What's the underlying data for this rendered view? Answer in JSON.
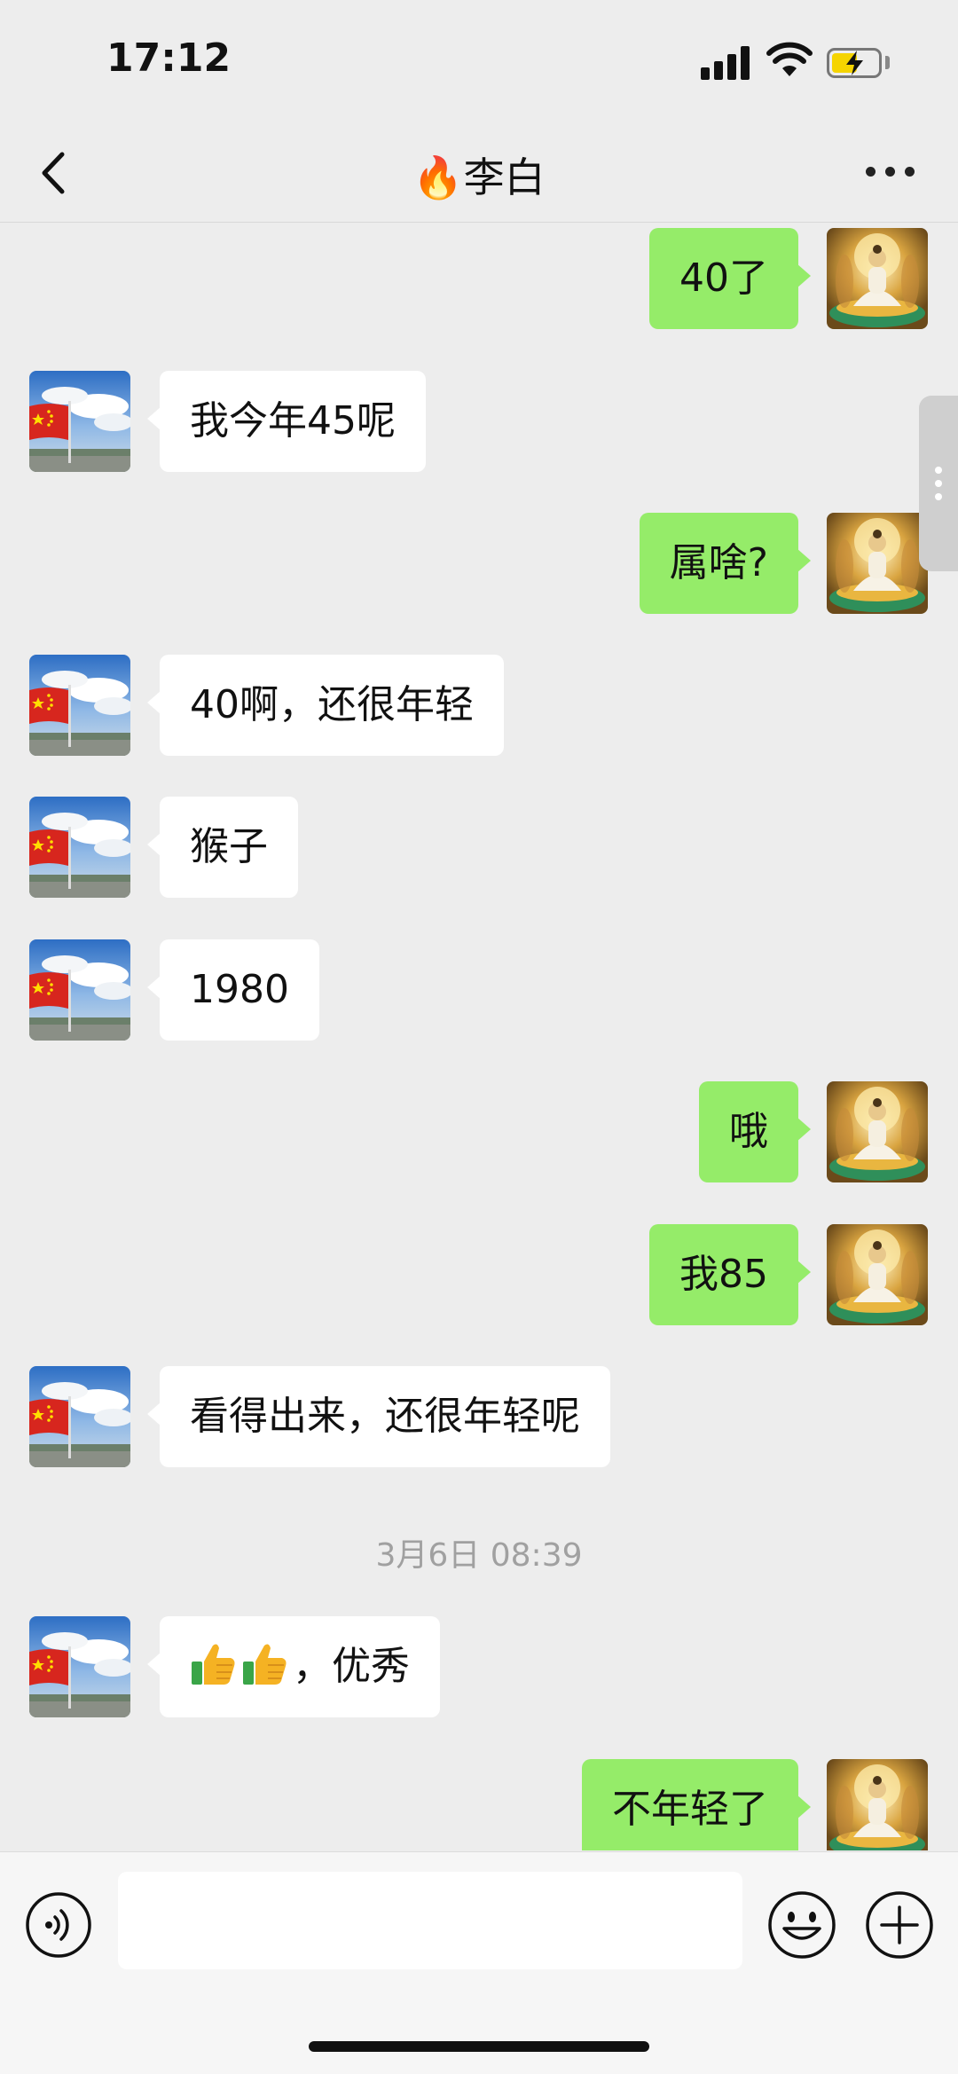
{
  "status": {
    "time": "17:12"
  },
  "header": {
    "title": "🔥李白"
  },
  "messages": [
    {
      "side": "right",
      "text": "40了"
    },
    {
      "side": "left",
      "text": "我今年45呢"
    },
    {
      "side": "right",
      "text": "属啥?"
    },
    {
      "side": "left",
      "text": "40啊，还很年轻"
    },
    {
      "side": "left",
      "text": "猴子"
    },
    {
      "side": "left",
      "text": "1980"
    },
    {
      "side": "right",
      "text": "哦"
    },
    {
      "side": "right",
      "text": "我85"
    },
    {
      "side": "left",
      "text": "看得出来，还很年轻呢"
    },
    {
      "timestamp": "3月6日 08:39"
    },
    {
      "side": "left",
      "text": "，优秀",
      "prefix_icons": [
        "thumbs-up-icon",
        "thumbs-up-icon"
      ]
    },
    {
      "side": "right",
      "text": "不年轻了"
    }
  ],
  "input": {
    "value": ""
  },
  "colors": {
    "sent_bubble": "#95ec69",
    "received_bubble": "#ffffff",
    "background": "#ededed"
  }
}
